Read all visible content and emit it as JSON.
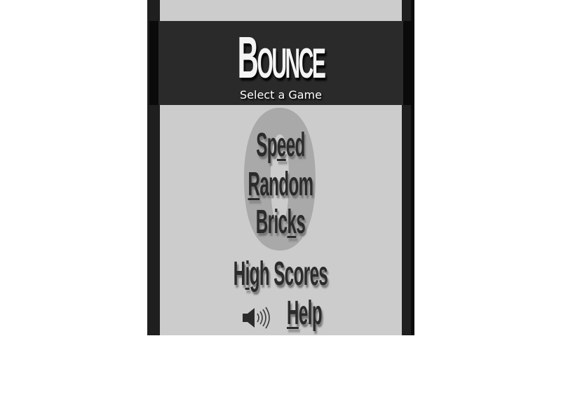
{
  "game": {
    "title_first_letter": "B",
    "title_rest": "OUNCE",
    "subtitle": "Select a Game"
  },
  "watermark": {
    "glyph": "0"
  },
  "menu": {
    "speed": {
      "before": "Sp",
      "hotkey": "e",
      "after": "ed"
    },
    "random": {
      "before": "",
      "hotkey": "R",
      "after": "andom"
    },
    "bricks": {
      "before": "Bric",
      "hotkey": "k",
      "after": "s"
    },
    "high_scores": {
      "before": "H",
      "hotkey": "i",
      "after": "gh Scores"
    },
    "help": {
      "before": "",
      "hotkey": "H",
      "after": "elp"
    }
  },
  "controls": {
    "sound_icon": "speaker-on-icon"
  },
  "colors": {
    "frame": "#1f1f1f",
    "panel": "#cccccc",
    "banner": "#2a2a2a",
    "menu_text": "#2b2b2b",
    "title_text": "#f4f4f4"
  }
}
